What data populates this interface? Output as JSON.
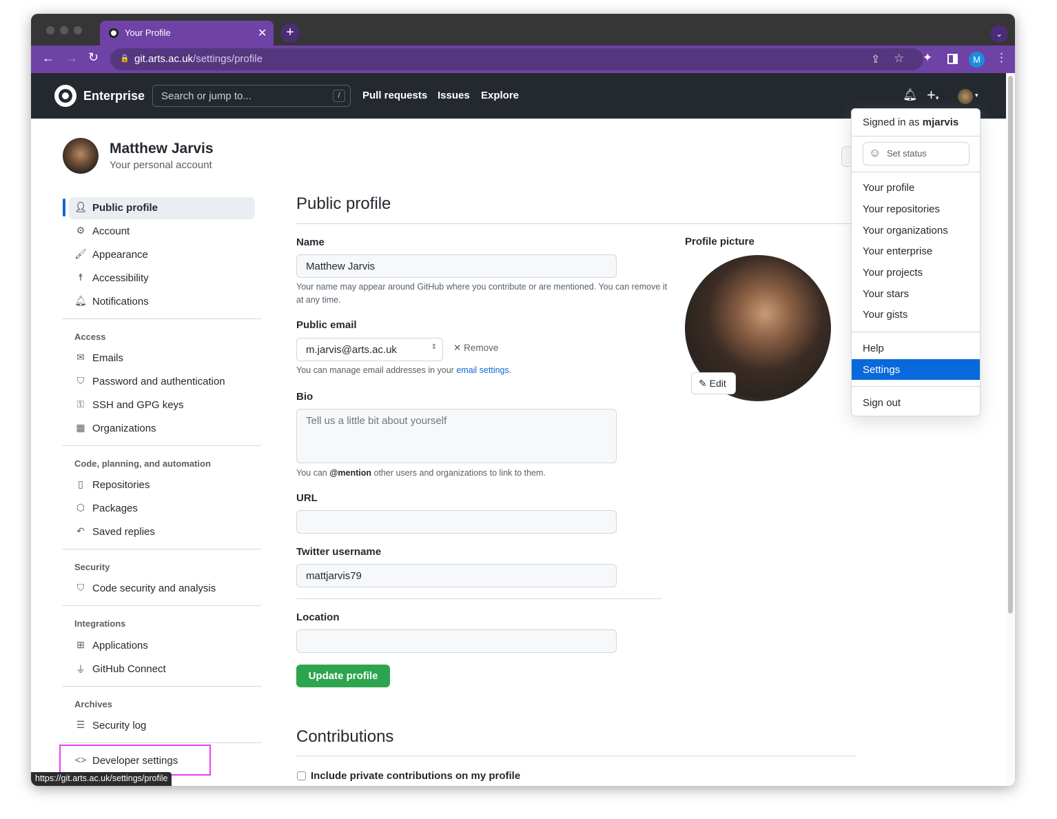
{
  "browser": {
    "tab_title": "Your Profile",
    "url_host": "git.arts.ac.uk",
    "url_path": "/settings/profile",
    "profile_initial": "M",
    "status_url": "https://git.arts.ac.uk/settings/profile"
  },
  "header": {
    "brand": "Enterprise",
    "search_placeholder": "Search or jump to...",
    "search_key": "/",
    "nav": [
      "Pull requests",
      "Issues",
      "Explore"
    ]
  },
  "account": {
    "name": "Matthew Jarvis",
    "subtitle": "Your personal account"
  },
  "sidebar": {
    "top": [
      "Public profile",
      "Account",
      "Appearance",
      "Accessibility",
      "Notifications"
    ],
    "access_h": "Access",
    "access": [
      "Emails",
      "Password and authentication",
      "SSH and GPG keys",
      "Organizations"
    ],
    "code_h": "Code, planning, and automation",
    "code": [
      "Repositories",
      "Packages",
      "Saved replies"
    ],
    "security_h": "Security",
    "security": [
      "Code security and analysis"
    ],
    "integrations_h": "Integrations",
    "integrations": [
      "Applications",
      "GitHub Connect"
    ],
    "archives_h": "Archives",
    "archives": [
      "Security log"
    ],
    "developer": "Developer settings"
  },
  "main": {
    "title": "Public profile",
    "name_label": "Name",
    "name_value": "Matthew Jarvis",
    "name_note": "Your name may appear around GitHub where you contribute or are mentioned. You can remove it at any time.",
    "email_label": "Public email",
    "email_value": "m.jarvis@arts.ac.uk",
    "remove": "Remove",
    "email_note_pre": "You can manage email addresses in your ",
    "email_note_link": "email settings",
    "email_note_post": ".",
    "bio_label": "Bio",
    "bio_placeholder": "Tell us a little bit about yourself",
    "bio_note_pre": "You can ",
    "bio_note_bold": "@mention",
    "bio_note_post": " other users and organizations to link to them.",
    "url_label": "URL",
    "url_value": "",
    "twitter_label": "Twitter username",
    "twitter_value": "mattjarvis79",
    "location_label": "Location",
    "location_value": "",
    "update": "Update profile",
    "picture_label": "Profile picture",
    "edit": "Edit",
    "contrib_title": "Contributions",
    "contrib_check": "Include private contributions on my profile"
  },
  "dropdown": {
    "signed_pre": "Signed in as ",
    "username": "mjarvis",
    "set_status": "Set status",
    "items": [
      "Your profile",
      "Your repositories",
      "Your organizations",
      "Your enterprise",
      "Your projects",
      "Your stars",
      "Your gists"
    ],
    "help": "Help",
    "settings": "Settings",
    "signout": "Sign out"
  },
  "colors": {
    "browser_purple": "#6f42a6",
    "header": "#24292f",
    "green": "#2da44e",
    "selected": "#0969da",
    "highlight": "#f03cf0"
  }
}
